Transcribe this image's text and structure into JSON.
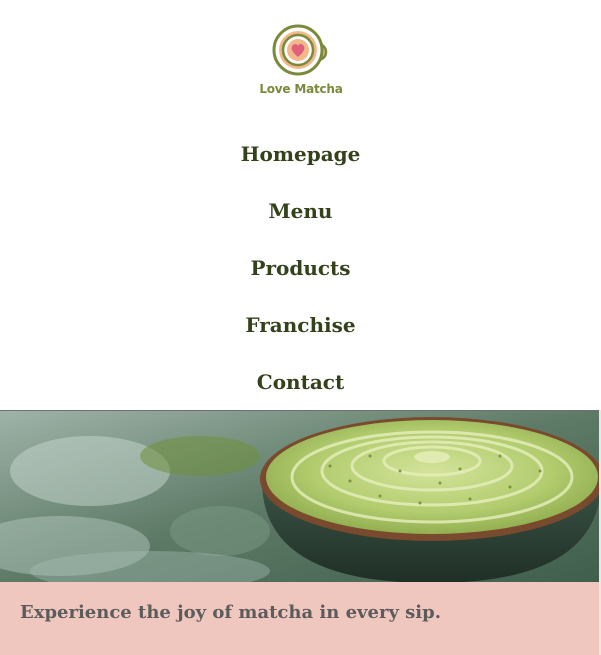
{
  "brand": {
    "name": "Love Matcha",
    "logo_icon": "matcha-cup-heart-icon"
  },
  "nav": {
    "items": [
      {
        "label": "Homepage"
      },
      {
        "label": "Menu"
      },
      {
        "label": "Products"
      },
      {
        "label": "Franchise"
      },
      {
        "label": "Contact"
      }
    ]
  },
  "hero": {
    "image": "matcha-latte-bowl-image"
  },
  "tagline": {
    "text": "Experience the joy of matcha in every sip."
  },
  "colors": {
    "nav_text": "#33421a",
    "logo_green": "#7a8a3a",
    "tagline_bg": "#f0c7bf",
    "tagline_text": "#5c5c5c"
  }
}
